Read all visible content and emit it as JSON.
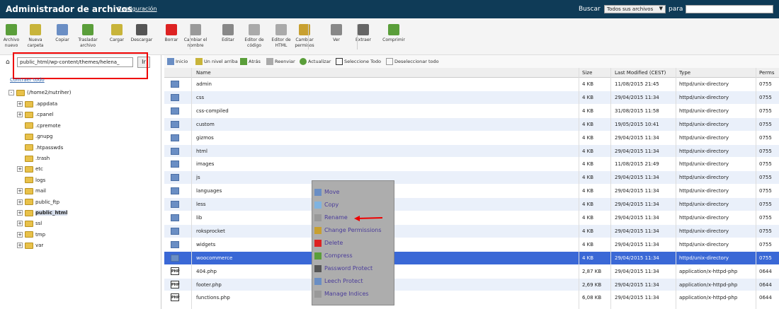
{
  "header": {
    "title": "Administrador de archivos",
    "config_link": "Configuración",
    "search_label": "Buscar",
    "search_scope": "Todos sus archivos",
    "search_for": "para",
    "search_value": ""
  },
  "toolbar": [
    {
      "label1": "Archivo",
      "label2": "nuevo",
      "icon": "new-file-icon",
      "color": "#5a9e3a"
    },
    {
      "label1": "Nueva",
      "label2": "carpeta",
      "icon": "new-folder-icon",
      "color": "#c8b43a"
    },
    {
      "label1": "Copiar",
      "label2": "",
      "icon": "copy-icon",
      "color": "#6a8ec4"
    },
    {
      "label1": "Trasladar",
      "label2": "archivo",
      "icon": "move-icon",
      "color": "#5a9e3a"
    },
    {
      "label1": "Cargar",
      "label2": "",
      "icon": "upload-icon",
      "color": "#c8b43a"
    },
    {
      "label1": "Descargar",
      "label2": "",
      "icon": "download-icon",
      "color": "#555"
    },
    {
      "label1": "Borrar",
      "label2": "",
      "icon": "delete-icon",
      "color": "#d22"
    },
    {
      "label1": "Cambiar el",
      "label2": "nombre",
      "icon": "rename-icon",
      "color": "#999"
    },
    {
      "label1": "Editar",
      "label2": "",
      "icon": "edit-icon",
      "color": "#888"
    },
    {
      "label1": "Editor de",
      "label2": "código",
      "icon": "code-editor-icon",
      "color": "#aaa"
    },
    {
      "label1": "Editor de",
      "label2": "HTML",
      "icon": "html-editor-icon",
      "color": "#aaa"
    },
    {
      "label1": "Cambiar",
      "label2": "permisos",
      "icon": "permissions-icon",
      "color": "#c8a030"
    },
    {
      "label1": "Ver",
      "label2": "",
      "icon": "view-icon",
      "color": "#888"
    },
    {
      "label1": "Extraer",
      "label2": "",
      "icon": "extract-icon",
      "color": "#666"
    },
    {
      "label1": "Comprimir",
      "label2": "",
      "icon": "compress-icon",
      "color": "#5a9e3a"
    }
  ],
  "left": {
    "path": "public_html/wp-content/themes/helena_",
    "go": "Ir",
    "collapse": "Contraer todo",
    "root": "(/home2/nutriher)",
    "tree": [
      ".appdata",
      ".cpanel",
      ".cpremote",
      ".gnupg",
      ".htpasswds",
      ".trash",
      "etc",
      "logs",
      "mail",
      "public_ftp",
      "public_html",
      "ssl",
      "tmp",
      "var"
    ]
  },
  "nav": {
    "home": "Inicio",
    "up": "Un nivel arriba",
    "back": "Atrás",
    "forward": "Reenviar",
    "reload": "Actualizar",
    "select_all": "Seleccione Todo",
    "deselect_all": "Deseleccionar todo"
  },
  "columns": {
    "name": "Name",
    "size": "Size",
    "modified": "Last Modified (CEST)",
    "type": "Type",
    "perms": "Perms"
  },
  "rows": [
    {
      "name": "admin",
      "size": "4 KB",
      "date": "11/08/2015 21:45",
      "type": "httpd/unix-directory",
      "perms": "0755"
    },
    {
      "name": "css",
      "size": "4 KB",
      "date": "29/04/2015 11:34",
      "type": "httpd/unix-directory",
      "perms": "0755"
    },
    {
      "name": "css-compiled",
      "size": "4 KB",
      "date": "31/08/2015 11:58",
      "type": "httpd/unix-directory",
      "perms": "0755"
    },
    {
      "name": "custom",
      "size": "4 KB",
      "date": "19/05/2015 10:41",
      "type": "httpd/unix-directory",
      "perms": "0755"
    },
    {
      "name": "gizmos",
      "size": "4 KB",
      "date": "29/04/2015 11:34",
      "type": "httpd/unix-directory",
      "perms": "0755"
    },
    {
      "name": "html",
      "size": "4 KB",
      "date": "29/04/2015 11:34",
      "type": "httpd/unix-directory",
      "perms": "0755"
    },
    {
      "name": "images",
      "size": "4 KB",
      "date": "11/08/2015 21:49",
      "type": "httpd/unix-directory",
      "perms": "0755"
    },
    {
      "name": "js",
      "size": "4 KB",
      "date": "29/04/2015 11:34",
      "type": "httpd/unix-directory",
      "perms": "0755"
    },
    {
      "name": "languages",
      "size": "4 KB",
      "date": "29/04/2015 11:34",
      "type": "httpd/unix-directory",
      "perms": "0755"
    },
    {
      "name": "less",
      "size": "4 KB",
      "date": "29/04/2015 11:34",
      "type": "httpd/unix-directory",
      "perms": "0755"
    },
    {
      "name": "lib",
      "size": "4 KB",
      "date": "29/04/2015 11:34",
      "type": "httpd/unix-directory",
      "perms": "0755"
    },
    {
      "name": "roksprocket",
      "size": "4 KB",
      "date": "29/04/2015 11:34",
      "type": "httpd/unix-directory",
      "perms": "0755"
    },
    {
      "name": "widgets",
      "size": "4 KB",
      "date": "29/04/2015 11:34",
      "type": "httpd/unix-directory",
      "perms": "0755"
    },
    {
      "name": "woocommerce",
      "size": "4 KB",
      "date": "29/04/2015 11:34",
      "type": "httpd/unix-directory",
      "perms": "0755"
    },
    {
      "name": "404.php",
      "size": "2,87 KB",
      "date": "29/04/2015 11:34",
      "type": "application/x-httpd-php",
      "perms": "0644"
    },
    {
      "name": "footer.php",
      "size": "2,69 KB",
      "date": "29/04/2015 11:34",
      "type": "application/x-httpd-php",
      "perms": "0644"
    },
    {
      "name": "functions.php",
      "size": "6,08 KB",
      "date": "29/04/2015 11:34",
      "type": "application/x-httpd-php",
      "perms": "0644"
    }
  ],
  "context_menu": [
    "Move",
    "Copy",
    "Rename",
    "Change Permissions",
    "Delete",
    "Compress",
    "Password Protect",
    "Leech Protect",
    "Manage Indices"
  ],
  "colors": {
    "header": "#0f3b57",
    "selected": "#3a68d6",
    "highlight": "#e00",
    "menu": "#adadad"
  }
}
